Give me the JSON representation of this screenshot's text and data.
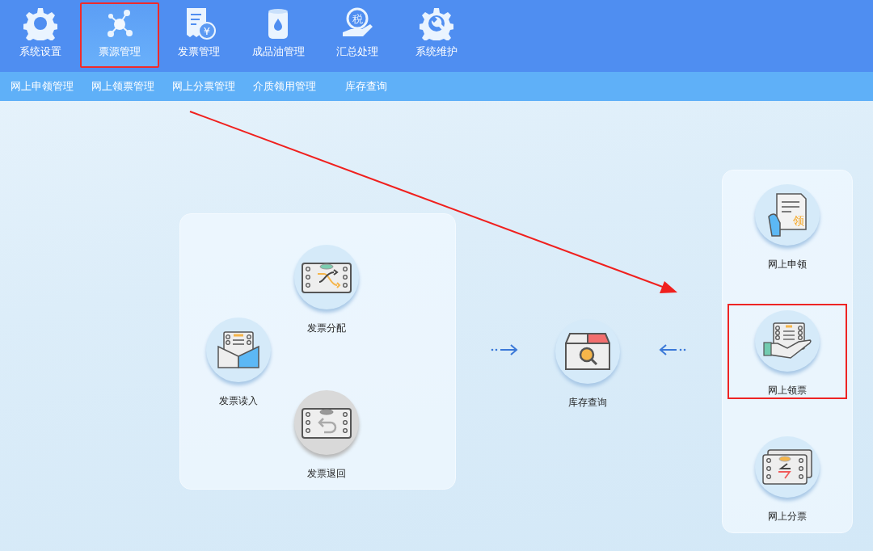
{
  "top_tabs": [
    {
      "label": "系统设置",
      "selected": false
    },
    {
      "label": "票源管理",
      "selected": true
    },
    {
      "label": "发票管理",
      "selected": false,
      "icon_text": "¥"
    },
    {
      "label": "成品油管理",
      "selected": false
    },
    {
      "label": "汇总处理",
      "selected": false,
      "icon_text": "税"
    },
    {
      "label": "系统维护",
      "selected": false
    }
  ],
  "sub_nav": [
    "网上申领管理",
    "网上领票管理",
    "网上分票管理",
    "介质领用管理",
    "库存查询"
  ],
  "invoice_group": [
    {
      "label": "发票分配",
      "disabled": false
    },
    {
      "label": "发票读入",
      "disabled": false
    },
    {
      "label": "发票退回",
      "disabled": true
    }
  ],
  "inventory": {
    "label": "库存查询"
  },
  "online_group": [
    {
      "label": "网上申领",
      "highlighted": false,
      "icon_text": "领"
    },
    {
      "label": "网上领票",
      "highlighted": true
    },
    {
      "label": "网上分票",
      "highlighted": false
    }
  ]
}
